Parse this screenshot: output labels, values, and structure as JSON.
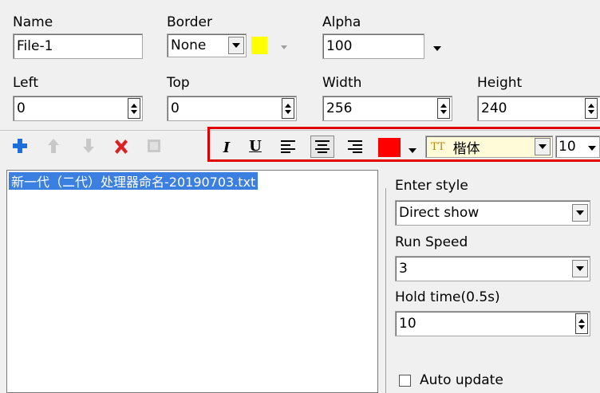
{
  "fields": {
    "name": {
      "label": "Name",
      "value": "File-1"
    },
    "border": {
      "label": "Border",
      "value": "None"
    },
    "alpha": {
      "label": "Alpha",
      "value": "100"
    },
    "left": {
      "label": "Left",
      "value": "0"
    },
    "top": {
      "label": "Top",
      "value": "0"
    },
    "width": {
      "label": "Width",
      "value": "256"
    },
    "height": {
      "label": "Height",
      "value": "240"
    }
  },
  "colors": {
    "border_color": "#ffff00",
    "text_color": "#ff0000",
    "highlight_box": "#e00000",
    "font_field_bg": "#fffbd8",
    "add_icon": "#1e6fd9",
    "delete_icon": "#e02020"
  },
  "toolbar": {
    "left_icons": [
      "add-icon",
      "move-up-icon",
      "move-down-icon",
      "delete-icon",
      "properties-icon"
    ],
    "format": {
      "italic": "I",
      "underline": "U",
      "font_icon_text": "TT",
      "font_name": "楷体",
      "font_size": "10"
    }
  },
  "list": {
    "items": [
      "新一代（二代）处理器命名-20190703.txt"
    ]
  },
  "right_panel": {
    "enter_style": {
      "label": "Enter style",
      "value": "Direct show"
    },
    "run_speed": {
      "label": "Run Speed",
      "value": "3"
    },
    "hold_time": {
      "label": "Hold time(0.5s)",
      "value": "10"
    },
    "auto_update": {
      "label": "Auto update",
      "checked": false
    }
  }
}
